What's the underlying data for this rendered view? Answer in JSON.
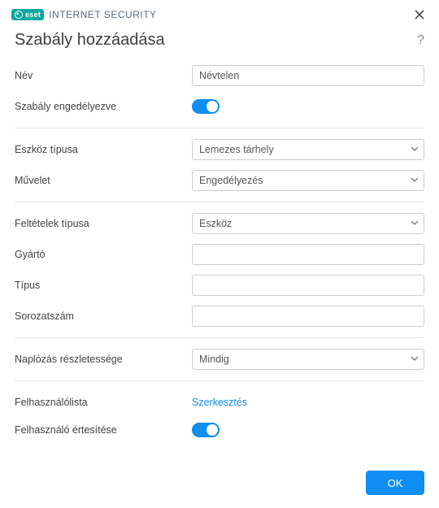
{
  "brand": {
    "bold": "INTERNET",
    "thin": "SECURITY",
    "logo_text": "eset"
  },
  "page": {
    "title": "Szabály hozzáadása"
  },
  "labels": {
    "name": "Név",
    "rule_enabled": "Szabály engedélyezve",
    "device_type": "Eszköz típusa",
    "action": "Művelet",
    "criteria_type": "Feltételek típusa",
    "vendor": "Gyártó",
    "model": "Típus",
    "serial": "Sorozatszám",
    "log_severity": "Naplózás részletessége",
    "user_list": "Felhasználólista",
    "notify_user": "Felhasználó értesítése"
  },
  "values": {
    "name": "Névtelen",
    "device_type": "Lemezes tárhely",
    "action": "Engedélyezés",
    "criteria_type": "Eszköz",
    "vendor": "",
    "model": "",
    "serial": "",
    "log_severity": "Mindig"
  },
  "links": {
    "edit": "Szerkesztés"
  },
  "buttons": {
    "ok": "OK"
  }
}
